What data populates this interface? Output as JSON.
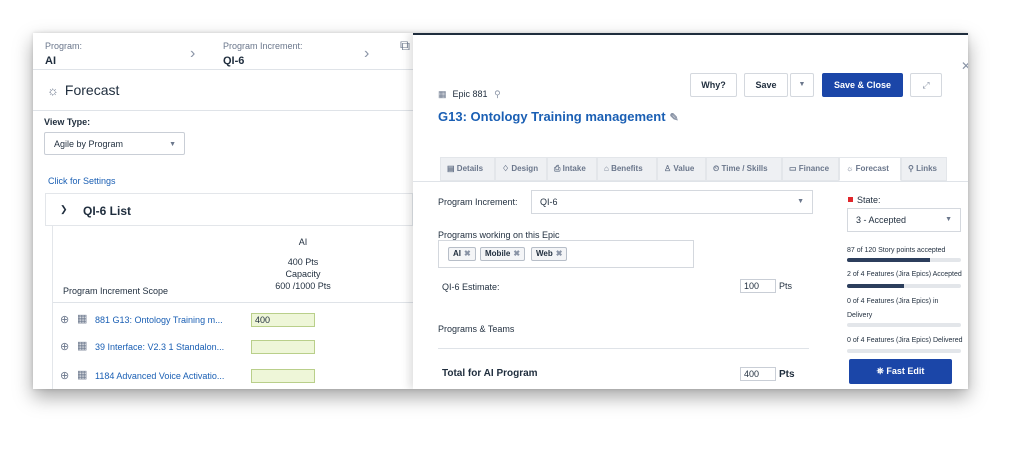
{
  "breadcrumb": {
    "program_label": "Program:",
    "program_value": "AI",
    "pi_label": "Program Increment:",
    "pi_value": "QI-6"
  },
  "left": {
    "title": "Forecast",
    "view_type_label": "View Type:",
    "view_type_value": "Agile by Program",
    "settings_link": "Click for Settings",
    "list_title": "QI-6 List",
    "col_program": "AI",
    "col_pts": "400 Pts",
    "col_capacity_label": "Capacity",
    "col_capacity": "600 /1000 Pts",
    "scope_label": "Program Increment Scope",
    "rows": [
      {
        "name": "881 G13: Ontology Training m...",
        "value": "400"
      },
      {
        "name": "39 Interface: V2.3 1 Standalon...",
        "value": ""
      },
      {
        "name": "1184 Advanced Voice Activatio...",
        "value": ""
      }
    ]
  },
  "right": {
    "epic_label": "Epic 881",
    "epic_title": "G13: Ontology Training management",
    "buttons": {
      "why": "Why?",
      "save": "Save",
      "save_close": "Save & Close"
    },
    "tabs": [
      {
        "label": "Details",
        "icon": "▤"
      },
      {
        "label": "Design",
        "icon": "♢"
      },
      {
        "label": "Intake",
        "icon": "⎙"
      },
      {
        "label": "Benefits",
        "icon": "⌂"
      },
      {
        "label": "Value",
        "icon": "♙"
      },
      {
        "label": "Time / Skills",
        "icon": "⏲"
      },
      {
        "label": "Finance",
        "icon": "▭"
      },
      {
        "label": "Forecast",
        "icon": "☼"
      },
      {
        "label": "Links",
        "icon": "⚲"
      }
    ],
    "pi_label": "Program Increment:",
    "pi_value": "QI-6",
    "programs_label": "Programs working on this Epic",
    "chips": [
      "AI",
      "Mobile",
      "Web"
    ],
    "estimate_label": "QI-6 Estimate:",
    "estimate_value": "100",
    "estimate_unit": "Pts",
    "teams_label": "Programs & Teams",
    "total_label": "Total for AI Program",
    "total_value": "400",
    "total_unit": "Pts",
    "state_label": "State:",
    "state_value": "3 - Accepted",
    "stat1": "87 of 120 Story points accepted",
    "stat1_fraction": 0.725,
    "stat2": "2 of 4 Features (Jira Epics) Accepted",
    "stat2_fraction": 0.5,
    "stat3": "0 of 4 Features (Jira Epics) in Delivery",
    "stat3_fraction": 0,
    "stat4": "0 of 4 Features (Jira Epics) Delivered",
    "stat4_fraction": 0,
    "fast_edit": "Fast Edit"
  },
  "colors": {
    "link": "#1a5fb4",
    "primary_button": "#1b46a8",
    "state_marker": "#e0262b",
    "progress": "#2c3e5c"
  }
}
